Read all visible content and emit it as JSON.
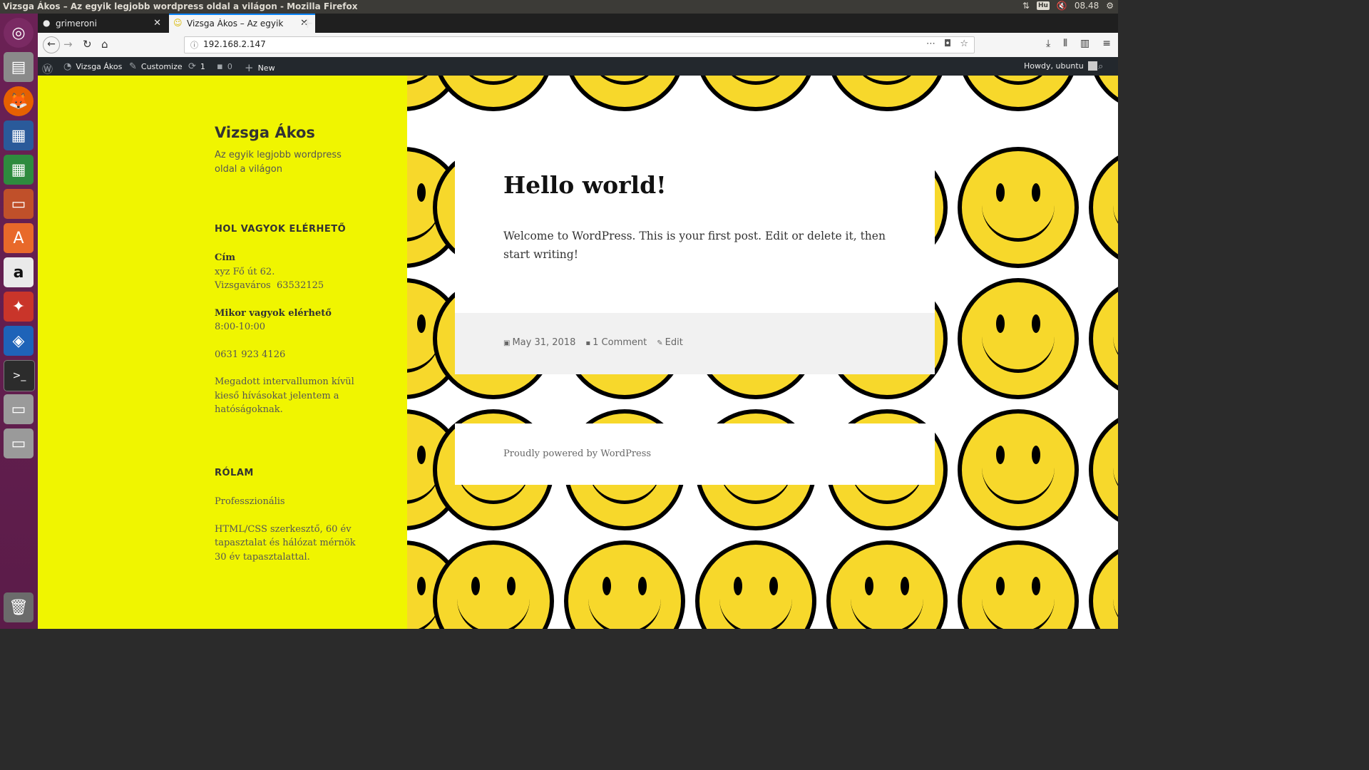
{
  "os": {
    "window_title": "Vizsga Ákos – Az egyik legjobb wordpress oldal a világon - Mozilla Firefox",
    "keyboard_layout": "Hu",
    "clock": "08.48"
  },
  "browser": {
    "tabs": [
      {
        "label": "grimeroni",
        "active": false
      },
      {
        "label": "Vizsga Ákos – Az egyik le",
        "active": true
      }
    ],
    "url": "192.168.2.147"
  },
  "adminbar": {
    "site_name": "Vizsga Ákos",
    "customize": "Customize",
    "updates_count": "1",
    "comments_count": "0",
    "new_label": "New",
    "howdy": "Howdy, ubuntu"
  },
  "sidebar": {
    "site_title": "Vizsga Ákos",
    "site_description": "Az egyik legjobb wordpress oldal a világon",
    "widget1_title": "HOL VAGYOK ELÉRHETŐ",
    "address_label": "Cím",
    "address_line1": "xyz Fő út 62.",
    "address_line2": "Vizsgaváros  63532125",
    "hours_label": "Mikor vagyok elérhető",
    "hours_value": "8:00-10:00",
    "phone": "0631 923 4126",
    "note": "Megadott intervallumon kívül kieső hívásokat jelentem a hatóságoknak.",
    "widget2_title": "RÓLAM",
    "about1": "Professzionális",
    "about2": "HTML/CSS szerkesztő, 60 év tapasztalat és hálózat mérnök 30 év tapasztalattal."
  },
  "post": {
    "title": "Hello world!",
    "content": "Welcome to WordPress. This is your first post. Edit or delete it, then start writing!",
    "date": "May 31, 2018",
    "comments": "1 Comment",
    "edit": "Edit"
  },
  "footer": {
    "powered": "Proudly powered by WordPress"
  },
  "colors": {
    "sidebar_bg": "#f0f500",
    "smiley_fill": "#f7d82b",
    "admin_bar": "#23282d",
    "launcher": "#5b1c49"
  }
}
